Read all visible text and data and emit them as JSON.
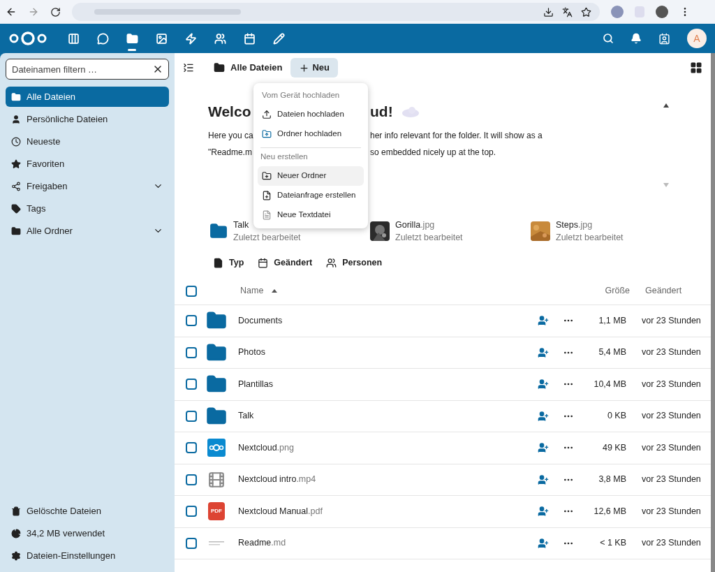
{
  "header": {
    "avatar": "A",
    "apps": [
      {
        "kind": "dashboard",
        "selected": false
      },
      {
        "kind": "talk",
        "selected": false
      },
      {
        "kind": "files",
        "selected": true
      },
      {
        "kind": "photos",
        "selected": false
      },
      {
        "kind": "activity",
        "selected": false
      },
      {
        "kind": "contacts",
        "selected": false
      },
      {
        "kind": "calendar",
        "selected": false
      },
      {
        "kind": "notes",
        "selected": false
      }
    ]
  },
  "sidebar": {
    "filter": {
      "placeholder": "Dateinamen filtern …"
    },
    "items": [
      {
        "kind": "all",
        "label": "Alle Dateien",
        "selected": true
      },
      {
        "kind": "personal",
        "label": "Persönliche Dateien",
        "selected": false
      },
      {
        "kind": "recent",
        "label": "Neueste",
        "selected": false
      },
      {
        "kind": "favorites",
        "label": "Favoriten",
        "selected": false
      },
      {
        "kind": "shares",
        "label": "Freigaben",
        "selected": false,
        "expanded": false
      },
      {
        "kind": "tags",
        "label": "Tags",
        "selected": false
      },
      {
        "kind": "folders",
        "label": "Alle Ordner",
        "selected": false,
        "expanded": false
      }
    ],
    "footer": [
      {
        "kind": "trash",
        "label": "Gelöschte Dateien"
      },
      {
        "kind": "quota",
        "label": "34,2 MB verwendet"
      },
      {
        "kind": "settings",
        "label": "Dateien-Einstellungen"
      }
    ]
  },
  "breadcrumb": {
    "label": "Alle Dateien",
    "new_button": "Neu"
  },
  "new_menu": {
    "sections": [
      {
        "title": "Vom Gerät hochladen",
        "items": [
          {
            "kind": "upload",
            "label": "Dateien hochladen",
            "selected": false
          },
          {
            "kind": "folder-upload",
            "label": "Ordner hochladen",
            "selected": false
          }
        ]
      },
      {
        "title": "Neu erstellen",
        "items": [
          {
            "kind": "new-folder",
            "label": "Neuer Ordner",
            "selected": true
          },
          {
            "kind": "request",
            "label": "Dateianfrage erstellen",
            "selected": false
          },
          {
            "kind": "text",
            "label": "Neue Textdatei",
            "selected": false
          }
        ]
      }
    ]
  },
  "readme": {
    "title_parts": [
      "Welco",
      "ud!"
    ],
    "line_1_parts": [
      "Here you ca",
      "her info relevant for the folder. It will show as a"
    ],
    "line_2_parts": [
      "\"Readme.m",
      "so embedded nicely up at the top."
    ]
  },
  "recent": [
    {
      "kind": "folder",
      "name": "Talk",
      "subtitle": "Zuletzt bearbeitet"
    },
    {
      "kind": "picture",
      "name": "Gorilla",
      "ext": ".jpg",
      "subtitle": "Zuletzt bearbeitet"
    },
    {
      "kind": "picture",
      "name": "Steps",
      "ext": ".jpg",
      "subtitle": "Zuletzt bearbeitet"
    }
  ],
  "filters": [
    {
      "kind": "type",
      "label": "Typ"
    },
    {
      "kind": "modified",
      "label": "Geändert"
    },
    {
      "kind": "people",
      "label": "Personen"
    }
  ],
  "table": {
    "all_checked": false,
    "columns": [
      "Name",
      "Größe",
      "Geändert"
    ],
    "rows": [
      {
        "kind": "folder",
        "name": "Documents",
        "size": "1,1 MB",
        "modified": "vor 23 Stunden",
        "checked": false
      },
      {
        "kind": "folder",
        "name": "Photos",
        "size": "5,4 MB",
        "modified": "vor 23 Stunden",
        "checked": false
      },
      {
        "kind": "folder",
        "name": "Plantillas",
        "size": "10,4 MB",
        "modified": "vor 23 Stunden",
        "checked": false
      },
      {
        "kind": "folder",
        "name": "Talk",
        "size": "0 KB",
        "modified": "vor 23 Stunden",
        "checked": false
      },
      {
        "kind": "logo",
        "name": "Nextcloud",
        "ext": ".png",
        "size": "49 KB",
        "modified": "vor 23 Stunden",
        "checked": false
      },
      {
        "kind": "video",
        "name": "Nextcloud intro",
        "ext": ".mp4",
        "size": "3,8 MB",
        "modified": "vor 23 Stunden",
        "checked": false
      },
      {
        "kind": "pdf",
        "name": "Nextcloud Manual",
        "ext": ".pdf",
        "icon_text": "PDF",
        "size": "12,6 MB",
        "modified": "vor 23 Stunden",
        "checked": false
      },
      {
        "kind": "doc",
        "name": "Readme",
        "ext": ".md",
        "size": "< 1 KB",
        "modified": "vor 23 Stunden",
        "checked": false
      }
    ]
  }
}
